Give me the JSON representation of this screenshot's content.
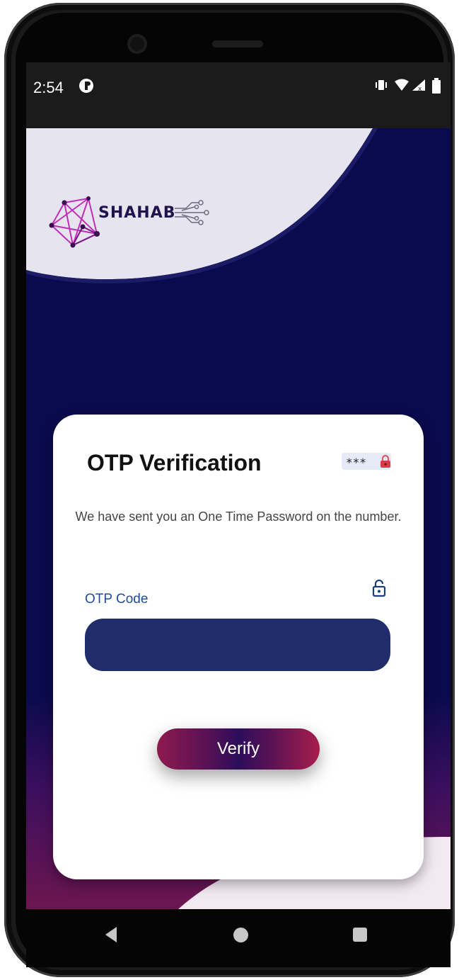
{
  "status_bar": {
    "time": "2:54",
    "icons": [
      "notification-icon",
      "vibrate-icon",
      "wifi-icon",
      "signal-icon",
      "battery-icon"
    ]
  },
  "brand": {
    "logo_text": "SHAHAB",
    "colors": {
      "background": "#0a0a4e",
      "logo_magenta": "#c02fb8",
      "input_fill": "#1f2d6b",
      "accent_maroon": "#8e1a4f"
    }
  },
  "card": {
    "title": "OTP Verification",
    "password_badge": {
      "stars": "***",
      "icon": "lock-icon"
    },
    "description": "We have sent you an One Time Password on the number.",
    "otp_field": {
      "label": "OTP Code",
      "value": "",
      "placeholder": "",
      "icon": "unlock-icon"
    },
    "verify_label": "Verify"
  },
  "nav_bar": {
    "buttons": [
      "back-icon",
      "home-icon",
      "recent-apps-icon"
    ]
  }
}
